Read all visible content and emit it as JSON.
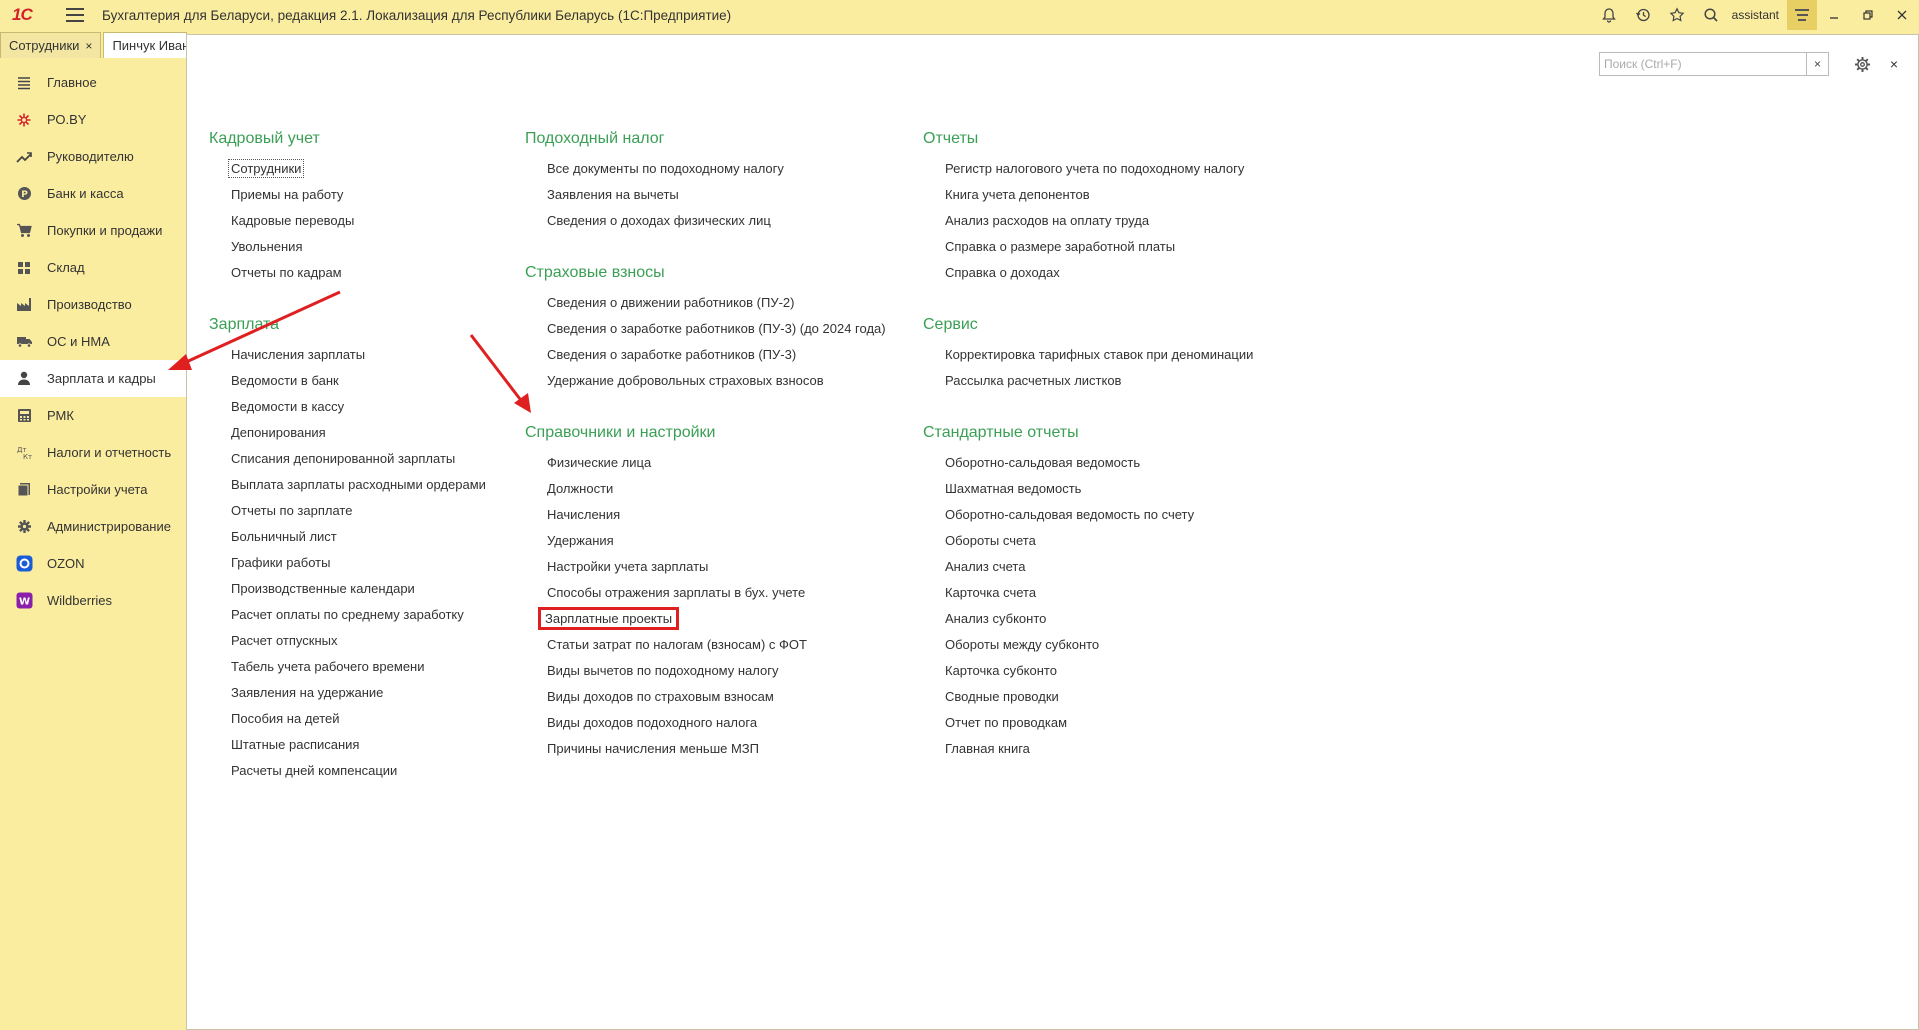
{
  "app": {
    "logo": "1С",
    "title": "Бухгалтерия для Беларуси, редакция 2.1. Локализация для Республики Беларусь   (1С:Предприятие)",
    "user": "assistant"
  },
  "tabs": [
    {
      "label": "Сотрудники",
      "close": "×"
    },
    {
      "label": "Пинчук Иван"
    }
  ],
  "sidebar": {
    "items": [
      {
        "label": "Главное",
        "icon": "list-icon"
      },
      {
        "label": "РО.BY",
        "icon": "ro-by-icon"
      },
      {
        "label": "Руководителю",
        "icon": "trend-icon"
      },
      {
        "label": "Банк и касса",
        "icon": "bank-icon"
      },
      {
        "label": "Покупки и продажи",
        "icon": "cart-icon"
      },
      {
        "label": "Склад",
        "icon": "warehouse-icon"
      },
      {
        "label": "Производство",
        "icon": "factory-icon"
      },
      {
        "label": "ОС и НМА",
        "icon": "truck-icon"
      },
      {
        "label": "Зарплата и кадры",
        "icon": "person-icon",
        "active": true
      },
      {
        "label": "РМК",
        "icon": "register-icon"
      },
      {
        "label": "Налоги и отчетность",
        "icon": "tax-icon"
      },
      {
        "label": "Настройки учета",
        "icon": "book-icon"
      },
      {
        "label": "Администрирование",
        "icon": "gear-icon"
      },
      {
        "label": "OZON",
        "icon": "ozon-icon"
      },
      {
        "label": "Wildberries",
        "icon": "wildberries-icon"
      }
    ]
  },
  "search": {
    "placeholder": "Поиск (Ctrl+F)",
    "value": "",
    "clear": "×"
  },
  "close_symbol": "×",
  "columns": [
    {
      "sections": [
        {
          "title": "Кадровый учет",
          "links": [
            "Сотрудники",
            "Приемы на работу",
            "Кадровые переводы",
            "Увольнения",
            "Отчеты по кадрам"
          ]
        },
        {
          "title": "Зарплата",
          "links": [
            "Начисления зарплаты",
            "Ведомости в банк",
            "Ведомости в кассу",
            "Депонирования",
            "Списания депонированной зарплаты",
            "Выплата зарплаты расходными ордерами",
            "Отчеты по зарплате",
            "Больничный лист",
            "Графики работы",
            "Производственные календари",
            "Расчет оплаты по среднему заработку",
            "Расчет отпускных",
            "Табель учета рабочего времени",
            "Заявления на удержание",
            "Пособия на детей",
            "Штатные расписания",
            "Расчеты дней компенсации"
          ]
        }
      ]
    },
    {
      "sections": [
        {
          "title": "Подоходный налог",
          "links": [
            "Все документы по подоходному налогу",
            "Заявления на вычеты",
            "Сведения о доходах физических лиц"
          ]
        },
        {
          "title": "Страховые взносы",
          "links": [
            "Сведения о движении работников (ПУ-2)",
            "Сведения о заработке работников (ПУ-3) (до 2024 года)",
            "Сведения о заработке работников (ПУ-3)",
            "Удержание добровольных страховых взносов"
          ]
        },
        {
          "title": "Справочники и настройки",
          "links": [
            "Физические лица",
            "Должности",
            "Начисления",
            "Удержания",
            "Настройки учета зарплаты",
            "Способы отражения зарплаты в бух. учете",
            "Зарплатные проекты",
            "Статьи затрат по налогам (взносам) с ФОТ",
            "Виды вычетов по подоходному налогу",
            "Виды доходов по страховым взносам",
            "Виды доходов подоходного налога",
            "Причины начисления меньше МЗП"
          ]
        }
      ]
    },
    {
      "sections": [
        {
          "title": "Отчеты",
          "links": [
            "Регистр налогового учета по подоходному налогу",
            "Книга учета депонентов",
            "Анализ расходов на оплату труда",
            "Справка о размере заработной платы",
            "Справка о доходах"
          ]
        },
        {
          "title": "Сервис",
          "links": [
            "Корректировка тарифных ставок при деноминации",
            "Рассылка расчетных листков"
          ]
        },
        {
          "title": "Стандартные отчеты",
          "links": [
            "Оборотно-сальдовая ведомость",
            "Шахматная ведомость",
            "Оборотно-сальдовая ведомость по счету",
            "Обороты счета",
            "Анализ счета",
            "Карточка счета",
            "Анализ субконто",
            "Обороты между субконто",
            "Карточка субконто",
            "Сводные проводки",
            "Отчет по проводкам",
            "Главная книга"
          ]
        }
      ]
    }
  ],
  "focused_link": "Сотрудники",
  "highlighted_link": "Зарплатные проекты",
  "colors": {
    "accent": "#3ba055",
    "sidebar": "#fbeda0",
    "annotation": "#e02020"
  }
}
